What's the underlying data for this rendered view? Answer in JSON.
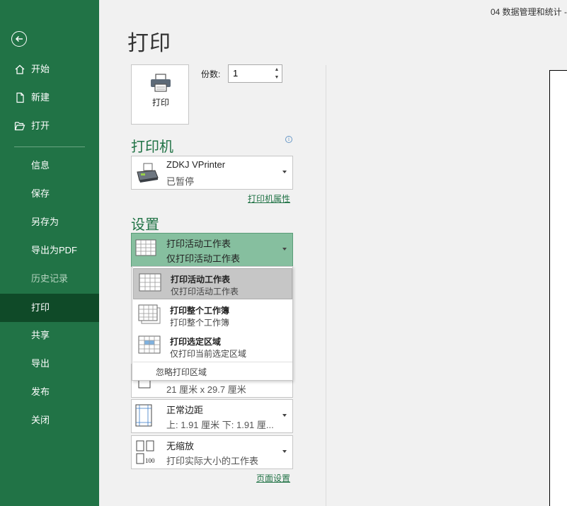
{
  "window": {
    "doc_title": "04 数据管理和统计 -"
  },
  "sidebar": {
    "back_icon": "back-arrow-icon",
    "items": [
      {
        "label": "开始",
        "icon": "home-icon"
      },
      {
        "label": "新建",
        "icon": "new-file-icon"
      },
      {
        "label": "打开",
        "icon": "folder-open-icon"
      },
      {
        "label": "信息"
      },
      {
        "label": "保存"
      },
      {
        "label": "另存为"
      },
      {
        "label": "导出为PDF"
      },
      {
        "label": "历史记录",
        "state": "disabled"
      },
      {
        "label": "打印",
        "state": "active"
      },
      {
        "label": "共享"
      },
      {
        "label": "导出"
      },
      {
        "label": "发布"
      },
      {
        "label": "关闭"
      }
    ]
  },
  "main": {
    "title": "打印",
    "print_button": {
      "label": "打印",
      "icon": "printer-icon"
    },
    "copies": {
      "label": "份数:",
      "value": "1"
    },
    "printer": {
      "heading": "打印机",
      "name": "ZDKJ VPrinter",
      "status": "已暂停",
      "properties_link": "打印机属性"
    },
    "settings": {
      "heading": "设置",
      "scope": {
        "title": "打印活动工作表",
        "subtitle": "仅打印活动工作表"
      },
      "scope_options": [
        {
          "title": "打印活动工作表",
          "subtitle": "仅打印活动工作表",
          "selected": true
        },
        {
          "title": "打印整个工作簿",
          "subtitle": "打印整个工作簿",
          "selected": false
        },
        {
          "title": "打印选定区域",
          "subtitle": "仅打印当前选定区域",
          "selected": false
        }
      ],
      "ignore_print_area": "忽略打印区域",
      "paper_size": {
        "subtitle": "21 厘米 x 29.7 厘米"
      },
      "margins": {
        "title": "正常边距",
        "subtitle": "上: 1.91 厘米 下: 1.91 厘..."
      },
      "scaling": {
        "title": "无缩放",
        "subtitle": "打印实际大小的工作表"
      },
      "page_setup_link": "页面设置"
    }
  },
  "colors": {
    "sidebar": "#217346",
    "active_item": "#0f4a28",
    "accent": "#217346",
    "selected_dropdown": "#86bf9f"
  }
}
